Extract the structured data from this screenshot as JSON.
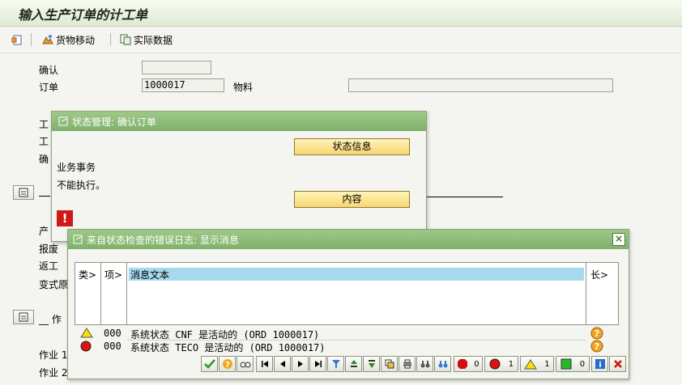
{
  "title": "输入生产订单的计工单",
  "toolbar": {
    "goods_movement": "货物移动",
    "actual_data": "实际数据"
  },
  "form": {
    "confirm_label": "确认",
    "confirm_value": "",
    "order_label": "订单",
    "order_value": "1000017",
    "material_label": "物料",
    "material_value": "",
    "hidden_labels": [
      "工",
      "工",
      "确"
    ],
    "side_labels": [
      "产",
      "报废",
      "返工",
      "变式原"
    ],
    "lower_text": "作",
    "op_labels": [
      "作业 1",
      "作业 2"
    ]
  },
  "status_dialog": {
    "title": "状态管理: 确认订单",
    "status_info_button": "状态信息",
    "business_transaction_label": "业务事务",
    "message": "不能执行。",
    "content_button": "内容"
  },
  "log_dialog": {
    "title": "来自状态检查的错误日志: 显示消息",
    "columns": [
      "类",
      "项",
      "消息文本",
      "长"
    ],
    "rows": [
      {
        "type": "warning",
        "item": "000",
        "text": "系统状态 CNF 是活动的 (ORD 1000017)"
      },
      {
        "type": "error",
        "item": "000",
        "text": "系统状态 TECO 是活动的 (ORD 1000017)"
      }
    ],
    "counts": {
      "stop": "0",
      "error": "1",
      "warning": "1",
      "success": "0"
    }
  }
}
